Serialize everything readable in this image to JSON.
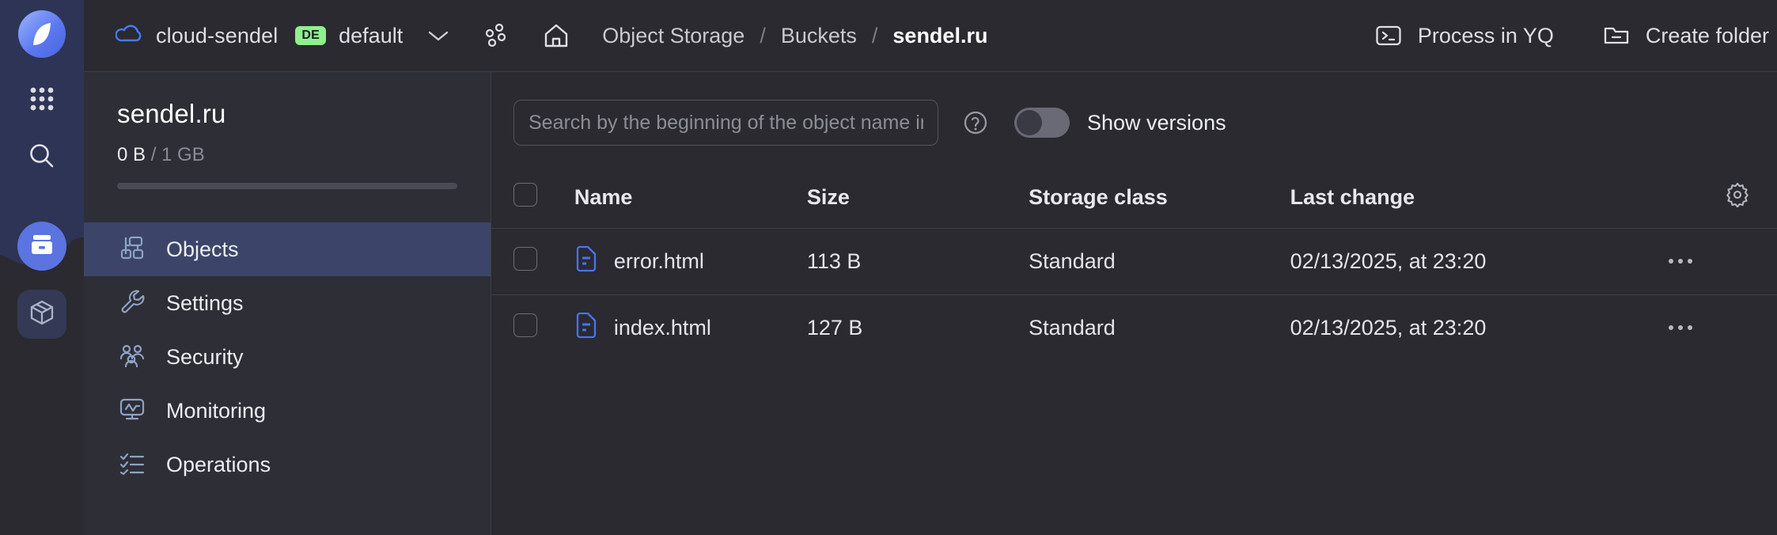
{
  "rail": {
    "logo": "yandex-cloud-logo",
    "items": [
      {
        "icon": "apps-grid-icon",
        "name": "all-services"
      },
      {
        "icon": "search-icon",
        "name": "global-search"
      },
      {
        "icon": "object-storage-icon",
        "name": "object-storage",
        "active": true
      },
      {
        "icon": "package-box-icon",
        "name": "container-registry"
      }
    ]
  },
  "topbar": {
    "cloud_icon": "cloud-icon",
    "cloud_name": "cloud-sendel",
    "folder_badge": "DE",
    "folder_name": "default",
    "chevron_icon": "chevron-down-icon",
    "services_icon": "services-dots-icon",
    "home_icon": "home-icon",
    "breadcrumb": {
      "items": [
        "Object Storage",
        "Buckets"
      ],
      "separator": "/",
      "current": "sendel.ru"
    },
    "actions": [
      {
        "label": "Process in YQ",
        "icon": "terminal-icon"
      },
      {
        "label": "Create folder",
        "icon": "folder-plus-icon"
      }
    ]
  },
  "sidebar": {
    "bucket_name": "sendel.ru",
    "quota_used": "0 B",
    "quota_total": "/ 1 GB",
    "progress_percent": 0,
    "items": [
      {
        "label": "Objects",
        "icon": "objects-tree-icon",
        "active": true
      },
      {
        "label": "Settings",
        "icon": "wrench-icon",
        "active": false
      },
      {
        "label": "Security",
        "icon": "users-shield-icon",
        "active": false
      },
      {
        "label": "Monitoring",
        "icon": "monitor-chart-icon",
        "active": false
      },
      {
        "label": "Operations",
        "icon": "checklist-icon",
        "active": false
      }
    ]
  },
  "toolbar": {
    "search_value": "",
    "search_placeholder": "Search by the beginning of the object name including",
    "help_icon": "question-circle-icon",
    "show_versions_label": "Show versions",
    "show_versions_on": false,
    "settings_icon": "gear-icon"
  },
  "table": {
    "columns": [
      "Name",
      "Size",
      "Storage class",
      "Last change"
    ],
    "rows": [
      {
        "name": "error.html",
        "size": "113 B",
        "storage_class": "Standard",
        "last_change": "02/13/2025, at 23:20",
        "icon": "html-file-icon",
        "selected": false,
        "menu_icon": "more-horizontal-icon"
      },
      {
        "name": "index.html",
        "size": "127 B",
        "storage_class": "Standard",
        "last_change": "02/13/2025, at 23:20",
        "icon": "html-file-icon",
        "selected": false,
        "menu_icon": "more-horizontal-icon"
      }
    ]
  },
  "colors": {
    "accent_blue": "#5b74e0",
    "badge_green": "#8ef08e",
    "file_icon_blue": "#4a72f5",
    "sidebar_active": "#3c4569",
    "background": "#2a2a30",
    "panel": "#2e2e36",
    "border": "#3c3c45"
  }
}
